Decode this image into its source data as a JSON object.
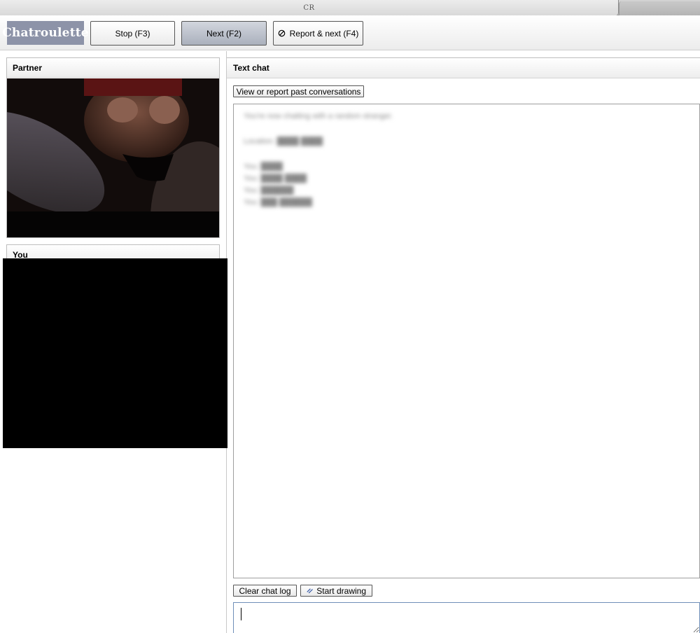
{
  "browser": {
    "tab_title": "CR"
  },
  "toolbar": {
    "logo": "Chatroulette",
    "stop_label": "Stop (F3)",
    "next_label": "Next (F2)",
    "report_label": "Report & next (F4)"
  },
  "panels": {
    "partner_title": "Partner",
    "you_title": "You",
    "chat_title": "Text chat"
  },
  "chat": {
    "history_button": "View or report past conversations",
    "clear_button": "Clear chat log",
    "draw_button": "Start drawing",
    "input_value": "",
    "blurred_lines": [
      "You're now chatting with a random stranger.",
      "Location: ████ ████",
      "",
      "You: ████",
      "You: ████ ████",
      "You: ██████",
      "You: ███ ██████"
    ]
  },
  "colors": {
    "logo_bg": "#8d93a8",
    "input_border": "#6f8fb8"
  },
  "icons": {
    "report": "ban-icon",
    "draw": "pencil-icon"
  }
}
